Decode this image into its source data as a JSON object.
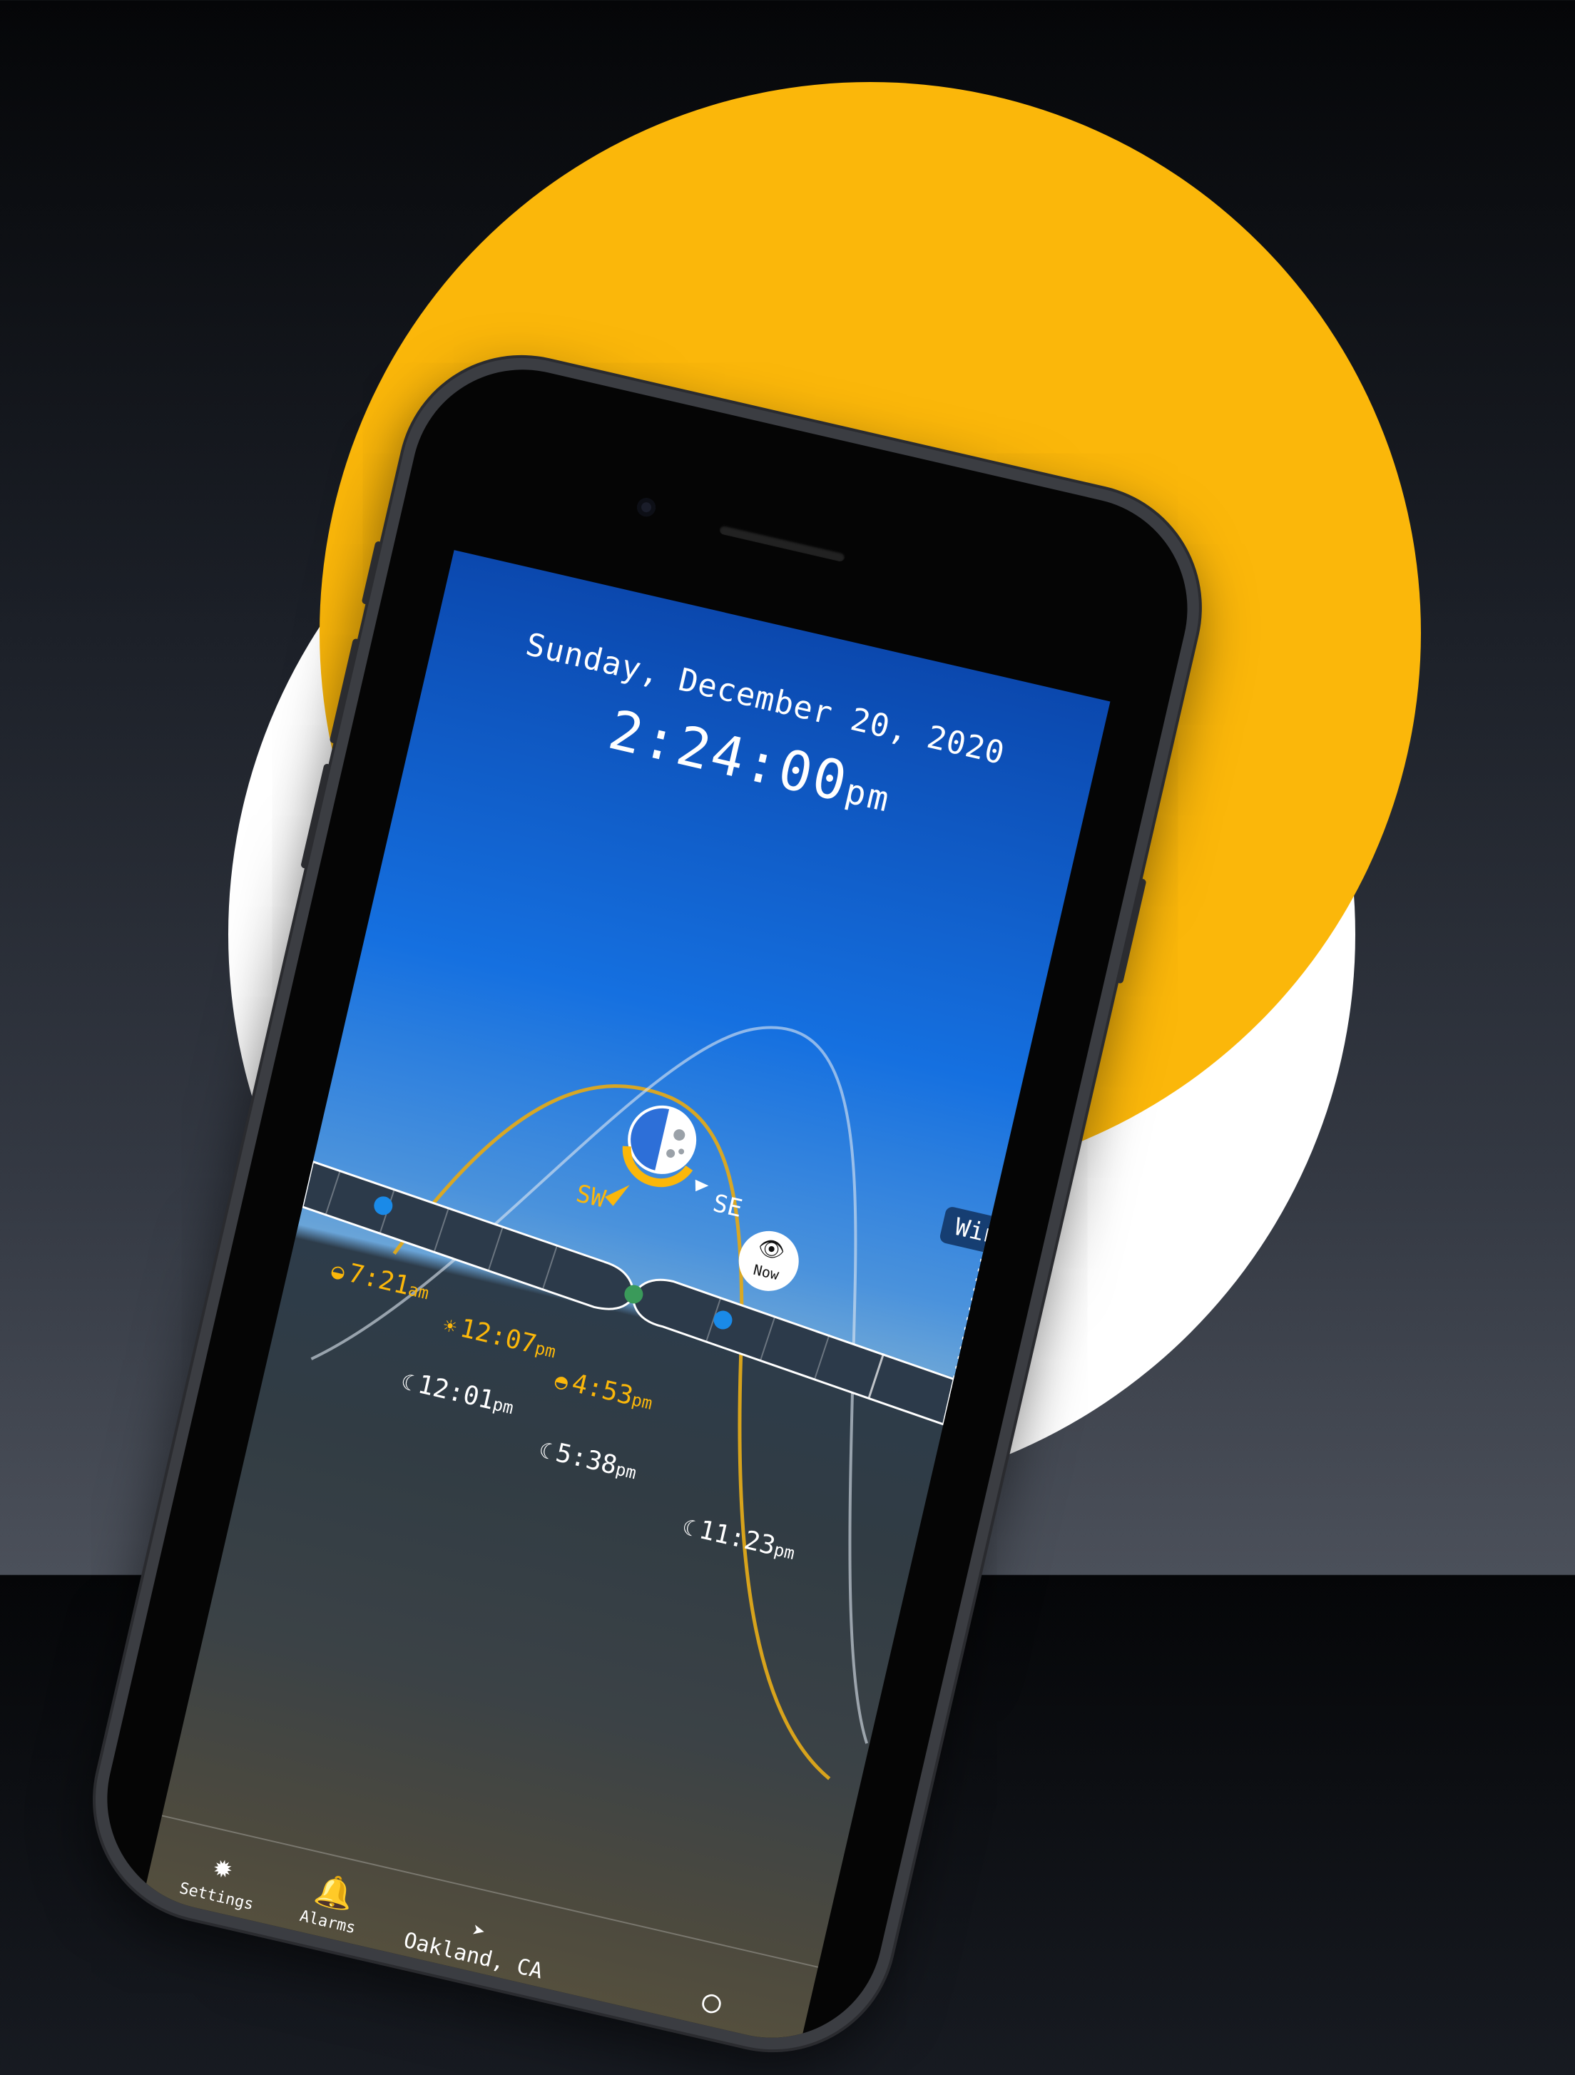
{
  "header": {
    "date": "Sunday, December 20, 2020",
    "time": "2:24:00",
    "ampm": "pm"
  },
  "season_marker": {
    "label": "Winter So"
  },
  "directions": {
    "sw": "SW",
    "se": "SE"
  },
  "now_badge": {
    "label": "Now"
  },
  "sun_times": [
    {
      "icon": "sunrise-icon",
      "time": "7:21",
      "suffix": "am"
    },
    {
      "icon": "sun-noon-icon",
      "time": "12:07",
      "suffix": "pm"
    },
    {
      "icon": "sunset-icon",
      "time": "4:53",
      "suffix": "pm"
    }
  ],
  "moon_times": [
    {
      "icon": "moonrise-icon",
      "time": "12:01",
      "suffix": "pm"
    },
    {
      "icon": "moon-transit-icon",
      "time": "5:38",
      "suffix": "pm"
    },
    {
      "icon": "moonset-icon",
      "time": "11:23",
      "suffix": "pm"
    }
  ],
  "tabs": {
    "settings": "Settings",
    "alarms": "Alarms",
    "location": "Oakland, CA"
  },
  "colors": {
    "accent": "#fbb70a",
    "sky_top": "#0b48ae",
    "sky_mid": "#1570e0",
    "night": "#2d3c4a"
  }
}
